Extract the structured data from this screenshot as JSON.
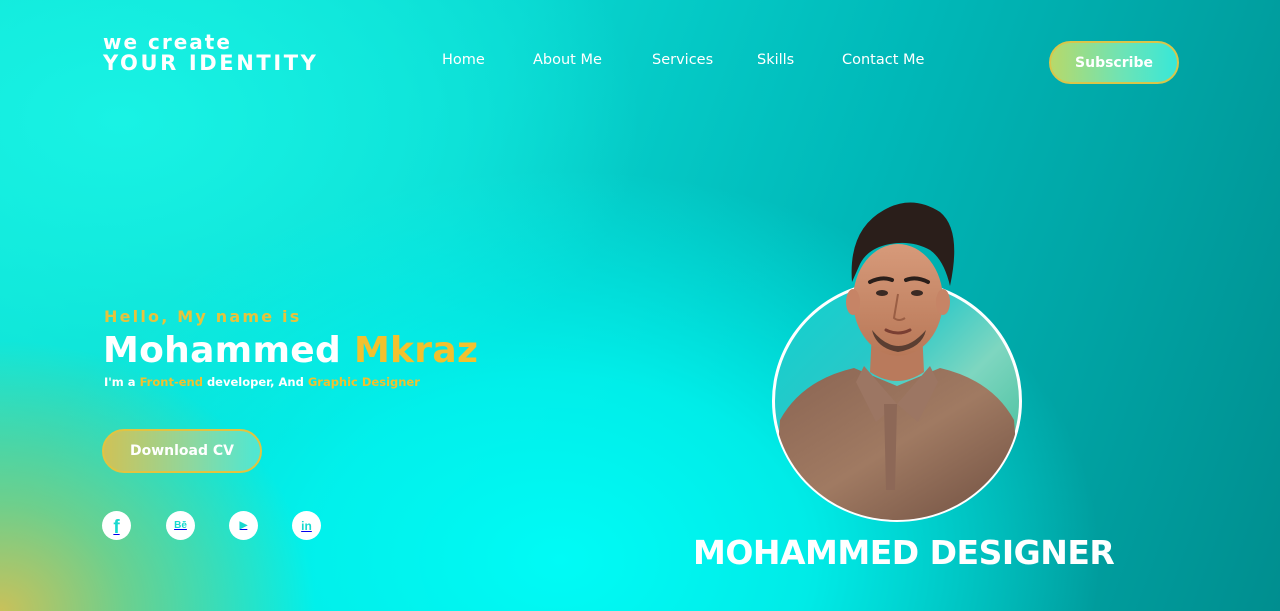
{
  "logo": {
    "line1": "we create",
    "line2": "YOUR IDENTITY"
  },
  "nav": {
    "items": [
      "Home",
      "About Me",
      "Services",
      "Skills",
      "Contact Me"
    ]
  },
  "header": {
    "subscribe_label": "Subscribe"
  },
  "hero": {
    "greeting": "Hello, My name is",
    "first_name": "Mohammed",
    "last_name": "Mkraz",
    "tagline": {
      "prefix": "I'm a ",
      "role1": "Front-end",
      "middle": " developer, And ",
      "role2": "Graphic Designer"
    },
    "download_label": "Download CV"
  },
  "socials": [
    {
      "icon": "facebook-icon",
      "glyph": "f"
    },
    {
      "icon": "behance-icon",
      "glyph": "Bē"
    },
    {
      "icon": "youtube-icon",
      "glyph": "▶"
    },
    {
      "icon": "linkedin-icon",
      "glyph": "in"
    }
  ],
  "portrait": {
    "caption": "MOHAMMED DESIGNER"
  },
  "colors": {
    "accent_yellow": "#f2c12e",
    "teal_dark": "#008e8f",
    "cyan_bright": "#00fbf6",
    "white": "#ffffff"
  }
}
